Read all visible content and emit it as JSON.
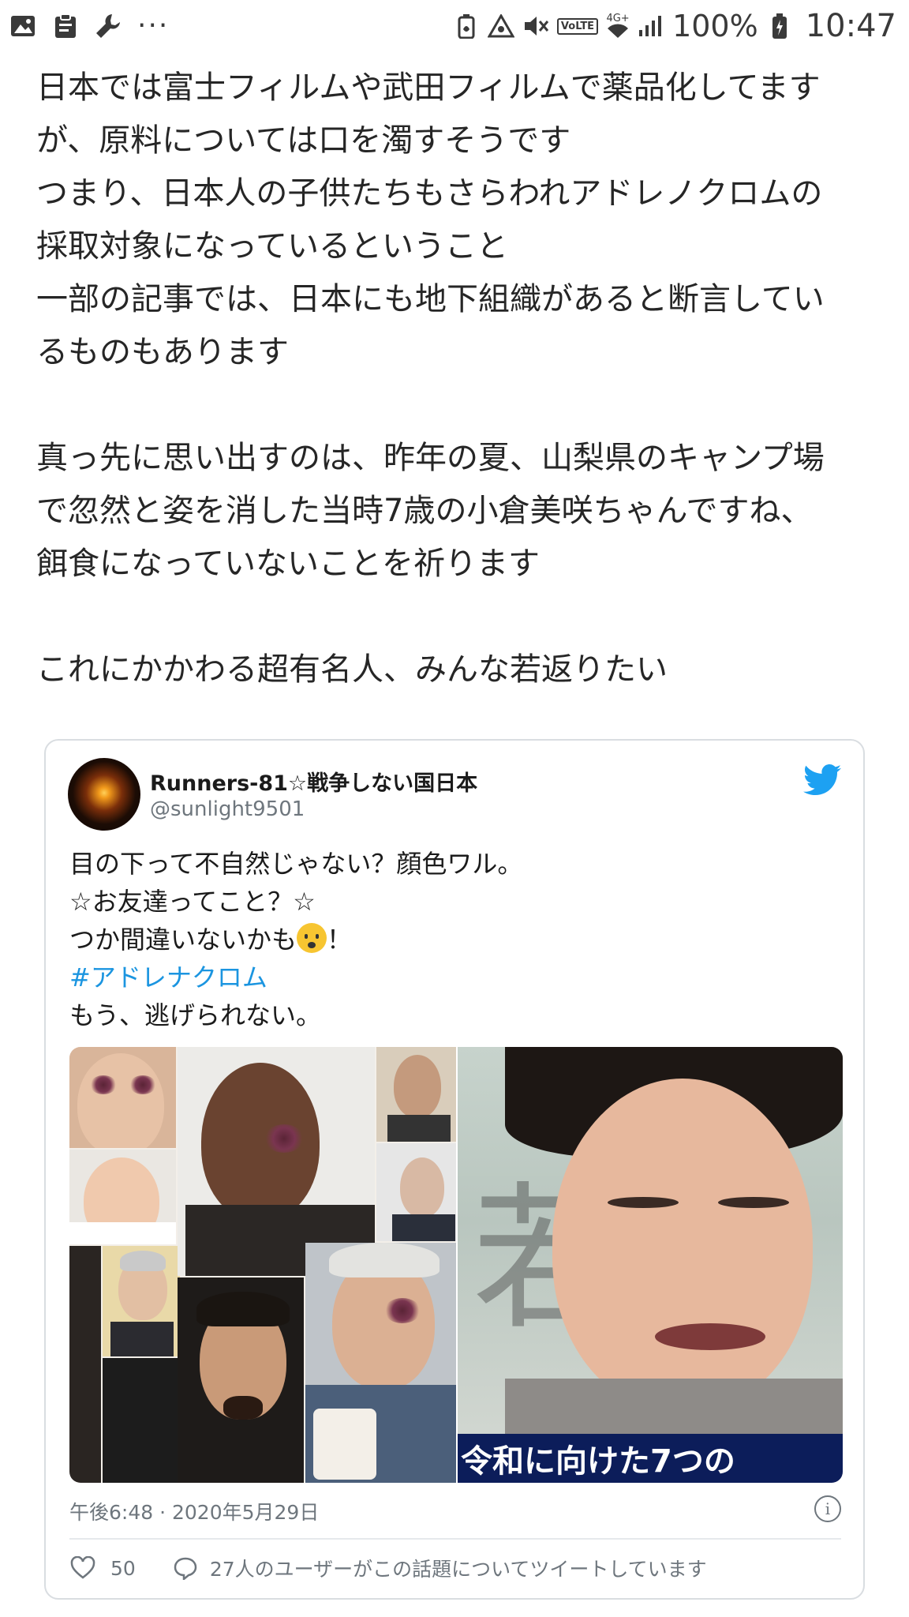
{
  "status_bar": {
    "icons_left": [
      "image-icon",
      "clipboard-icon",
      "wrench-icon"
    ],
    "more": "···",
    "volte": "VoLTE",
    "network": "4G+",
    "battery": "100%",
    "time": "10:47"
  },
  "post": {
    "lines": [
      "日本では富士フィルムや武田フィルムで薬品化してます",
      "が、原料については口を濁すそうです",
      "つまり、日本人の子供たちもさらわれアドレノクロムの",
      "採取対象になっているということ",
      "一部の記事では、日本にも地下組織があると断言してい",
      "るものもあります",
      "真っ先に思い出すのは、昨年の夏、山梨県のキャンプ場",
      "で忽然と姿を消した当時7歳の小倉美咲ちゃんですね、",
      "餌食になっていないことを祈ります",
      "これにかかわる超有名人、みんな若返りたい"
    ]
  },
  "embedded_tweet": {
    "author_name": "Runners-81☆戦争しない国日本",
    "author_handle": "@sunlight9501",
    "text_lines": {
      "line1": "目の下って不自然じゃない？顔色ワル。",
      "line2": "☆お友達ってこと？☆",
      "line3": "つか間違いないかも",
      "line3_end": "！",
      "hashtag": "#アドレナクロム",
      "line5": "もう、逃げられない。"
    },
    "media": {
      "bg_kanji": "若",
      "caption_banner": "令和に向けた7つの"
    },
    "timestamp": "午後6:48 · 2020年5月29日",
    "info": "i",
    "likes": "50",
    "reply_text": "27人のユーザーがこの話題についてツイートしています",
    "colors": {
      "hashtag": "#1b95e0",
      "brand": "#1da1f2",
      "muted": "#6e767d"
    }
  }
}
